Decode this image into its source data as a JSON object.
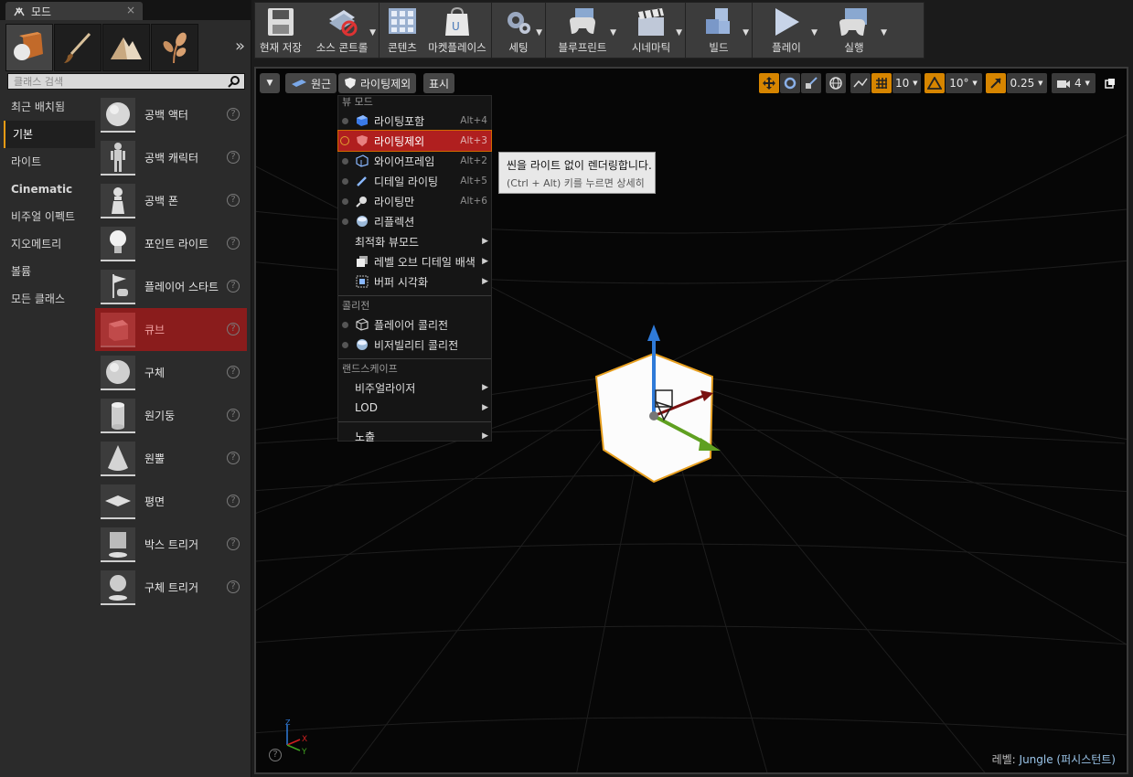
{
  "modes_tab": {
    "label": "모드",
    "close": "×"
  },
  "search": {
    "placeholder": "클래스 검색"
  },
  "categories": [
    {
      "label": "최근 배치됨"
    },
    {
      "label": "기본"
    },
    {
      "label": "라이트"
    },
    {
      "label": "Cinematic"
    },
    {
      "label": "비주얼 이펙트"
    },
    {
      "label": "지오메트리"
    },
    {
      "label": "볼륨"
    },
    {
      "label": "모든 클래스"
    }
  ],
  "assets": [
    {
      "label": "공백 액터"
    },
    {
      "label": "공백 캐릭터"
    },
    {
      "label": "공백 폰"
    },
    {
      "label": "포인트 라이트"
    },
    {
      "label": "플레이어 스타트"
    },
    {
      "label": "큐브"
    },
    {
      "label": "구체"
    },
    {
      "label": "원기둥"
    },
    {
      "label": "원뿔"
    },
    {
      "label": "평면"
    },
    {
      "label": "박스 트리거"
    },
    {
      "label": "구체 트리거"
    }
  ],
  "help_glyph": "?",
  "toolbar": {
    "save": "현재 저장",
    "source_control": "소스 콘트롤",
    "content": "콘텐츠",
    "marketplace": "마켓플레이스",
    "settings": "세팅",
    "blueprint": "블루프린트",
    "cinematic": "시네마틱",
    "build": "빌드",
    "play": "플레이",
    "launch": "실행"
  },
  "viewport": {
    "perspective": "원근",
    "view_mode": "라이팅제외",
    "show": "표시",
    "grid_snap": "10",
    "rot_snap": "10°",
    "scale_snap": "0.25",
    "camera_speed": "4",
    "level_prefix": "레벨:",
    "level_name": "Jungle (퍼시스턴트)"
  },
  "menu": {
    "section_view_mode": "뷰 모드",
    "lit": "라이팅포함",
    "lit_key": "Alt+4",
    "unlit": "라이팅제외",
    "unlit_key": "Alt+3",
    "wireframe": "와이어프레임",
    "wireframe_key": "Alt+2",
    "detail_lighting": "디테일 라이팅",
    "detail_lighting_key": "Alt+5",
    "lighting_only": "라이팅만",
    "lighting_only_key": "Alt+6",
    "reflections": "리플렉션",
    "optimization": "최적화 뷰모드",
    "lod_coloration": "레벨 오브 디테일 배색",
    "buffer_vis": "버퍼 시각화",
    "section_collision": "콜리전",
    "player_collision": "플레이어 콜리전",
    "visibility_collision": "비저빌리티 콜리전",
    "section_landscape": "랜드스케이프",
    "visualizers": "비주얼라이저",
    "lod": "LOD",
    "exposure": "노출"
  },
  "tooltip": {
    "line1": "씬을 라이트 없이 렌더링합니다.",
    "line2": "(Ctrl + Alt) 키를 누르면 상세히"
  },
  "colors": {
    "accent_orange": "#d68500",
    "selected_red": "#8a1c1c",
    "menu_highlight": "#b01f1f"
  }
}
